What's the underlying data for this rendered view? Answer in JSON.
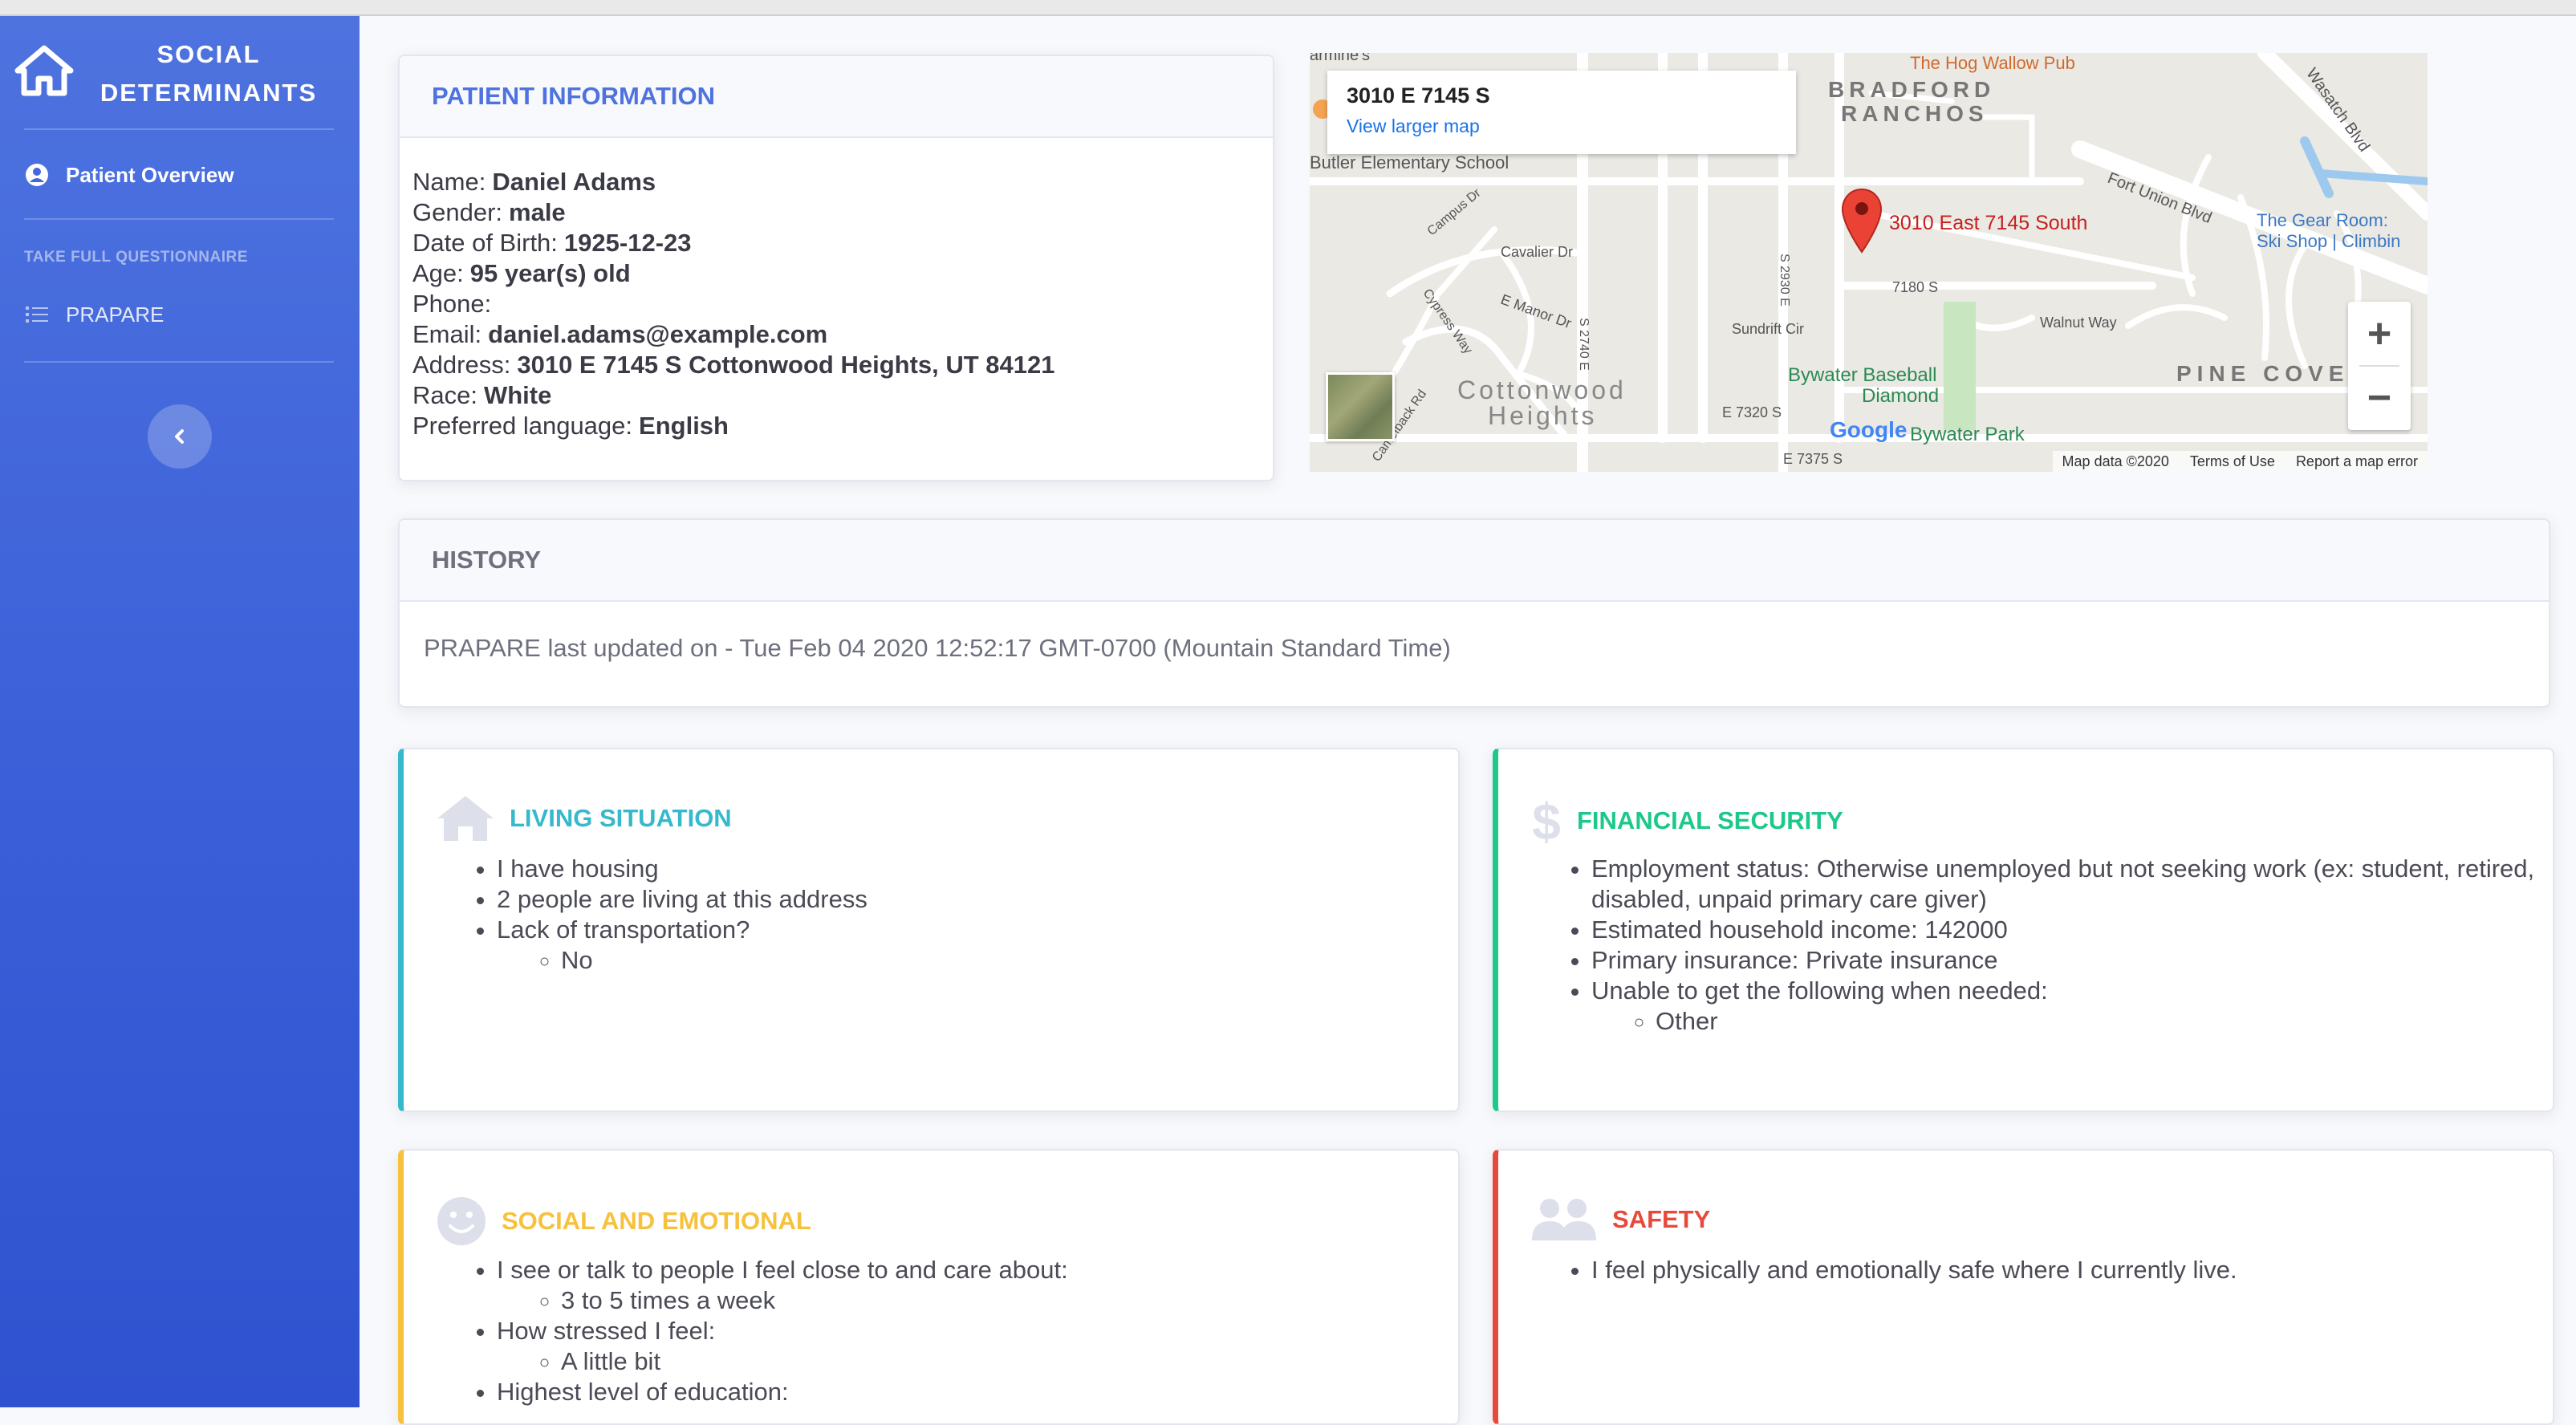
{
  "sidebar": {
    "brand_line1": "SOCIAL",
    "brand_line2": "DETERMINANTS",
    "nav_overview": "Patient Overview",
    "section_heading": "TAKE FULL QUESTIONNAIRE",
    "nav_prapare": "PRAPARE",
    "icons": {
      "brand": "home-icon",
      "overview": "user-circle-icon",
      "prapare": "list-icon",
      "toggle": "chevron-left-icon"
    }
  },
  "patient": {
    "header": "PATIENT INFORMATION",
    "fields": [
      {
        "label": "Name:",
        "value": "Daniel Adams"
      },
      {
        "label": "Gender:",
        "value": "male"
      },
      {
        "label": "Date of Birth:",
        "value": "1925-12-23"
      },
      {
        "label": "Age:",
        "value": "95 year(s) old"
      },
      {
        "label": "Phone:",
        "value": ""
      },
      {
        "label": "Email:",
        "value": "daniel.adams@example.com"
      },
      {
        "label": "Address:",
        "value": "3010 E 7145 S Cottonwood Heights, UT 84121"
      },
      {
        "label": "Race:",
        "value": "White"
      },
      {
        "label": "Preferred language:",
        "value": "English"
      }
    ]
  },
  "map": {
    "info_title": "3010 E 7145 S",
    "info_link": "View larger map",
    "pin_label": "3010 East 7145 South",
    "labels": {
      "hog_wallow": "The Hog Wallow Pub",
      "bradford": "BRADFORD",
      "ranchos": "RANCHOS",
      "butler": "Butler Elementary School",
      "fort_union": "Fort Union Blvd",
      "gear_room": "The Gear Room:",
      "ski_shop": "Ski Shop | Climbin",
      "cavalier": "Cavalier Dr",
      "manor": "E Manor Dr",
      "s7180": "7180 S",
      "sundrift": "Sundrift Cir",
      "walnut": "Walnut Way",
      "pine_cove": "PINE COVE",
      "bywater_baseball": "Bywater Baseball",
      "diamond": "Diamond",
      "bywater_park": "Bywater Park",
      "cottonwood": "Cottonwood",
      "heights": "Heights",
      "e7320": "E 7320 S",
      "e7375": "E 7375 S",
      "wasatch": "Wasatch Blvd",
      "campus": "Campus Dr",
      "cypress": "Cypress Way",
      "camelback": "Camelback Rd",
      "s2740": "S 2740 E",
      "s2930": "S 2930 E",
      "armines": "armine's",
      "google": "Google"
    },
    "footer_data": "Map data ©2020",
    "footer_terms": "Terms of Use",
    "footer_report": "Report a map error",
    "zoom_in": "+",
    "zoom_out": "−"
  },
  "history": {
    "header": "HISTORY",
    "text": "PRAPARE last updated on -  Tue Feb 04 2020 12:52:17 GMT-0700 (Mountain Standard Time)"
  },
  "living": {
    "title": "LIVING SITUATION",
    "color": "#36b9cc",
    "item1": "I have housing",
    "item2": "2 people are living at this address",
    "item3": "Lack of transportation?",
    "item3_sub": "No"
  },
  "financial": {
    "title": "FINANCIAL SECURITY",
    "color": "#1cc88a",
    "item1": "Employment status: Otherwise unemployed but not seeking work (ex: student, retired, disabled, unpaid primary care giver)",
    "item2": "Estimated household income: 142000",
    "item3": "Primary insurance: Private insurance",
    "item4": "Unable to get the following when needed:",
    "item4_sub": "Other"
  },
  "social": {
    "title": "SOCIAL AND EMOTIONAL",
    "color": "#f6c23e",
    "item1": "I see or talk to people I feel close to and care about:",
    "item1_sub": "3 to 5 times a week",
    "item2": "How stressed I feel:",
    "item2_sub": "A little bit",
    "item3": "Highest level of education:"
  },
  "safety": {
    "title": "SAFETY",
    "color": "#e74a3b",
    "item1": "I feel physically and emotionally safe where I currently live."
  }
}
